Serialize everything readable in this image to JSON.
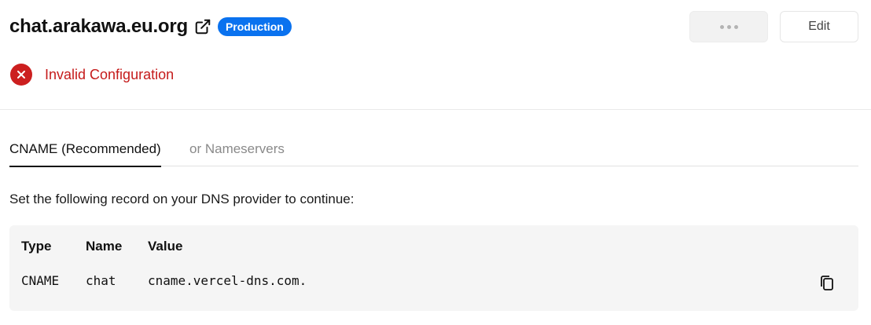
{
  "domain": {
    "name": "chat.arakawa.eu.org",
    "badge": "Production",
    "badge_color": "#0a72ef"
  },
  "actions": {
    "more_icon": "ellipsis-icon",
    "edit_label": "Edit"
  },
  "status": {
    "icon": "error-x-icon",
    "text": "Invalid Configuration",
    "color": "#c51b1b"
  },
  "tabs": [
    {
      "label": "CNAME (Recommended)",
      "active": true
    },
    {
      "label": "or Nameservers",
      "active": false
    }
  ],
  "instructions": "Set the following record on your DNS provider to continue:",
  "record": {
    "headers": [
      "Type",
      "Name",
      "Value"
    ],
    "type": "CNAME",
    "name": "chat",
    "value": "cname.vercel-dns.com.",
    "copy_icon": "copy-icon"
  }
}
